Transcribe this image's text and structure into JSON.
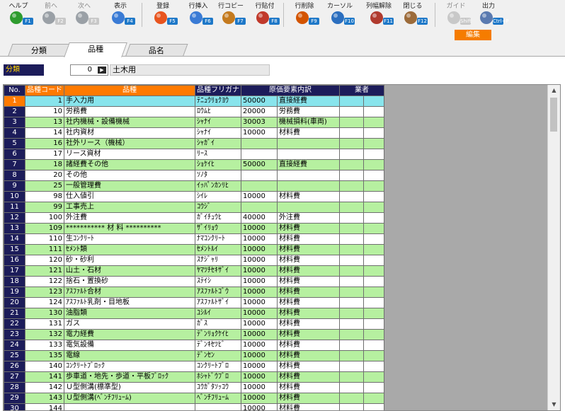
{
  "toolbar": {
    "buttons": [
      {
        "label": "ヘルプ",
        "key": "F1",
        "icon": "help-icon",
        "enabled": true
      },
      {
        "label": "前へ",
        "key": "F2",
        "icon": "arrow-left-icon",
        "enabled": false
      },
      {
        "label": "次へ",
        "key": "F3",
        "icon": "arrow-right-icon",
        "enabled": false
      },
      {
        "label": "表示",
        "key": "F4",
        "icon": "magnifier-icon",
        "enabled": true
      },
      {
        "label": "登録",
        "key": "F5",
        "icon": "ok-icon",
        "enabled": true
      },
      {
        "label": "行挿入",
        "key": "F6",
        "icon": "row-insert-icon",
        "enabled": true
      },
      {
        "label": "行コピー",
        "key": "F7",
        "icon": "row-copy-icon",
        "enabled": true
      },
      {
        "label": "行貼付",
        "key": "F8",
        "icon": "row-paste-icon",
        "enabled": true
      },
      {
        "label": "行削除",
        "key": "F9",
        "icon": "row-delete-icon",
        "enabled": true
      },
      {
        "label": "カーソル",
        "key": "F10",
        "icon": "cursor-icon",
        "enabled": true
      },
      {
        "label": "列幅解除",
        "key": "F11",
        "icon": "column-width-icon",
        "enabled": true
      },
      {
        "label": "閉じる",
        "key": "F12",
        "icon": "close-icon",
        "enabled": true
      },
      {
        "label": "ガイド",
        "key": "Shift",
        "icon": "guide-icon",
        "enabled": false
      },
      {
        "label": "出力",
        "key": "Ctrl+P",
        "icon": "print-icon",
        "enabled": true
      }
    ],
    "mode_badge": "編集"
  },
  "tabs": [
    {
      "label": "分類",
      "active": false
    },
    {
      "label": "品種",
      "active": true
    },
    {
      "label": "品名",
      "active": false
    }
  ],
  "filter": {
    "label": "分類",
    "value": "0",
    "button": "▶",
    "name": "土木用"
  },
  "grid": {
    "headers": [
      "No.",
      "品種コード",
      "品種",
      "品種フリガナ",
      "原価要素内訳",
      "業者"
    ],
    "rows": [
      {
        "no": "1",
        "code": "1",
        "name": "手入力用",
        "kana": "ﾃﾆｭｳﾘｮｸﾖｳ",
        "cost_code": "50000",
        "cost_name": "直接経費"
      },
      {
        "no": "2",
        "code": "10",
        "name": "労務費",
        "kana": "ﾛｳﾑﾋ",
        "cost_code": "20000",
        "cost_name": "労務費"
      },
      {
        "no": "3",
        "code": "13",
        "name": "社内機械・設備機械",
        "kana": "ｼｬﾅｲ",
        "cost_code": "30003",
        "cost_name": "機械損料(車両)"
      },
      {
        "no": "4",
        "code": "14",
        "name": "社内資材",
        "kana": "ｼｬﾅｲ",
        "cost_code": "10000",
        "cost_name": "材料費"
      },
      {
        "no": "5",
        "code": "16",
        "name": "社外リース（機械）",
        "kana": "ｼｬｶﾞｲ",
        "cost_code": "",
        "cost_name": ""
      },
      {
        "no": "6",
        "code": "17",
        "name": "リース資材",
        "kana": "ﾘｰｽ",
        "cost_code": "",
        "cost_name": ""
      },
      {
        "no": "7",
        "code": "18",
        "name": "諸経費その他",
        "kana": "ｼｮｹｲﾋ",
        "cost_code": "50000",
        "cost_name": "直接経費"
      },
      {
        "no": "8",
        "code": "20",
        "name": "その他",
        "kana": "ｿﾉﾀ",
        "cost_code": "",
        "cost_name": ""
      },
      {
        "no": "9",
        "code": "25",
        "name": "一般管理費",
        "kana": "ｲｯﾊﾟﾝｶﾝﾘﾋ",
        "cost_code": "",
        "cost_name": ""
      },
      {
        "no": "10",
        "code": "98",
        "name": "仕入値引",
        "kana": "ｼｲﾚ",
        "cost_code": "10000",
        "cost_name": "材料費"
      },
      {
        "no": "11",
        "code": "99",
        "name": "工事売上",
        "kana": "ｺｳｼﾞ",
        "cost_code": "",
        "cost_name": ""
      },
      {
        "no": "12",
        "code": "100",
        "name": "外注費",
        "kana": "ｶﾞｲﾁｭｳﾋ",
        "cost_code": "40000",
        "cost_name": "外注費"
      },
      {
        "no": "13",
        "code": "109",
        "name": "*********** 材 料 **********",
        "kana": "ｻﾞｲﾘｮｳ",
        "cost_code": "10000",
        "cost_name": "材料費"
      },
      {
        "no": "14",
        "code": "110",
        "name": "生ｺﾝｸﾘｰﾄ",
        "kana": "ﾅﾏｺﾝｸﾘｰﾄ",
        "cost_code": "10000",
        "cost_name": "材料費"
      },
      {
        "no": "15",
        "code": "111",
        "name": "ｾﾒﾝﾄ類",
        "kana": "ｾﾒﾝﾄﾙｲ",
        "cost_code": "10000",
        "cost_name": "材料費"
      },
      {
        "no": "16",
        "code": "120",
        "name": "砂・砂利",
        "kana": "ｽﾅｼﾞｬﾘ",
        "cost_code": "10000",
        "cost_name": "材料費"
      },
      {
        "no": "17",
        "code": "121",
        "name": "山土・石材",
        "kana": "ﾔﾏﾂﾁｾｷｻﾞｲ",
        "cost_code": "10000",
        "cost_name": "材料費"
      },
      {
        "no": "18",
        "code": "122",
        "name": "捨石・置換砂",
        "kana": "ｽﾃｲｼ",
        "cost_code": "10000",
        "cost_name": "材料費"
      },
      {
        "no": "19",
        "code": "123",
        "name": "ｱｽﾌｧﾙﾄ合材",
        "kana": "ｱｽﾌｧﾙﾄｺﾞｳ",
        "cost_code": "10000",
        "cost_name": "材料費"
      },
      {
        "no": "20",
        "code": "124",
        "name": "ｱｽﾌｧﾙﾄ乳剤・目地板",
        "kana": "ｱｽﾌｧﾙﾄｻﾞｲ",
        "cost_code": "10000",
        "cost_name": "材料費"
      },
      {
        "no": "21",
        "code": "130",
        "name": "油脂類",
        "kana": "ﾕｼﾙｲ",
        "cost_code": "10000",
        "cost_name": "材料費"
      },
      {
        "no": "22",
        "code": "131",
        "name": "ガス",
        "kana": "ｶﾞｽ",
        "cost_code": "10000",
        "cost_name": "材料費"
      },
      {
        "no": "23",
        "code": "132",
        "name": "電力経費",
        "kana": "ﾃﾞﾝﾘｮｸｹｲﾋ",
        "cost_code": "10000",
        "cost_name": "材料費"
      },
      {
        "no": "24",
        "code": "133",
        "name": "電気設備",
        "kana": "ﾃﾞﾝｷｾﾂﾋﾞ",
        "cost_code": "10000",
        "cost_name": "材料費"
      },
      {
        "no": "25",
        "code": "135",
        "name": "電線",
        "kana": "ﾃﾞﾝｾﾝ",
        "cost_code": "10000",
        "cost_name": "材料費"
      },
      {
        "no": "26",
        "code": "140",
        "name": "ｺﾝｸﾘｰﾄﾌﾞﾛｯｸ",
        "kana": "ｺﾝｸﾘｰﾄﾌﾞﾛ",
        "cost_code": "10000",
        "cost_name": "材料費"
      },
      {
        "no": "27",
        "code": "141",
        "name": "歩車道・地先・歩道・平板ﾌﾞﾛｯｸ",
        "kana": "ﾎｼｬﾄﾞｳﾌﾞﾛ",
        "cost_code": "10000",
        "cost_name": "材料費"
      },
      {
        "no": "28",
        "code": "142",
        "name": "Ｕ型側溝(標準型)",
        "kana": "ﾕｳｶﾞﾀｿｯｺｳ",
        "cost_code": "10000",
        "cost_name": "材料費"
      },
      {
        "no": "29",
        "code": "143",
        "name": "Ｕ型側溝(ﾍﾞﾝﾁﾌﾘｭｰﾑ)",
        "kana": "ﾍﾞﾝﾁﾌﾘｭｰﾑ",
        "cost_code": "10000",
        "cost_name": "材料費"
      },
      {
        "no": "30",
        "code": "144",
        "name": "",
        "kana": "",
        "cost_code": "10000",
        "cost_name": "材料費"
      }
    ]
  }
}
